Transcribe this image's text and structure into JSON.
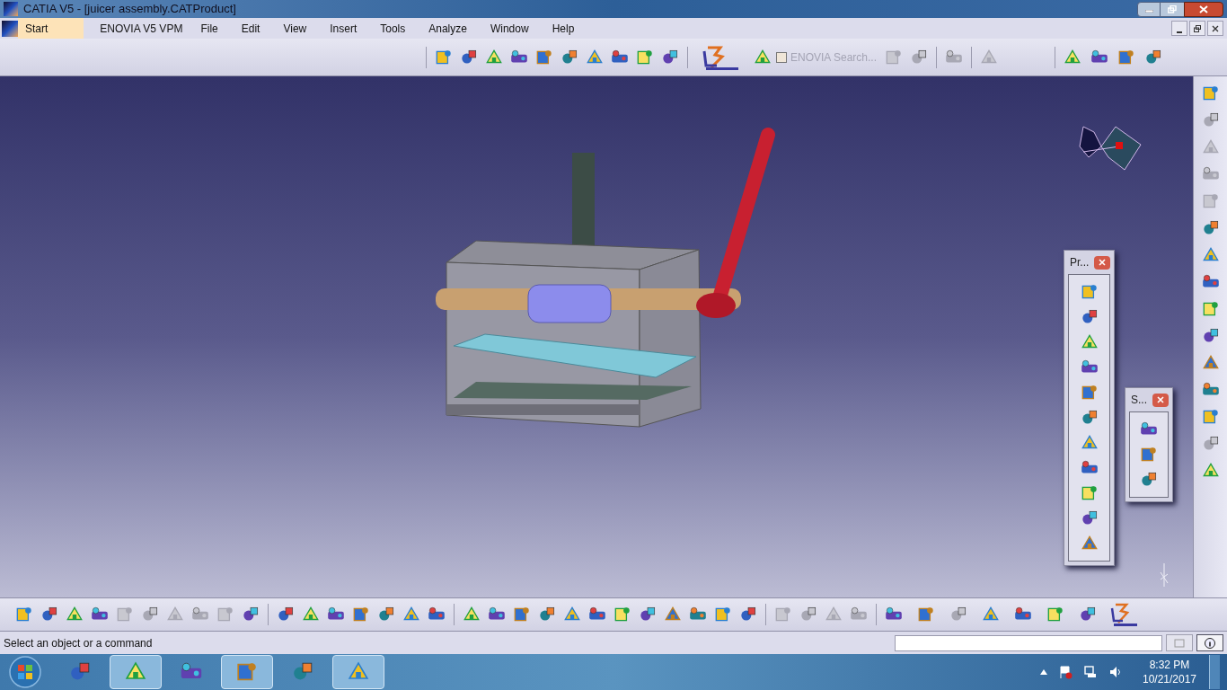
{
  "window": {
    "title": "CATIA V5 - [juicer assembly.CATProduct]"
  },
  "menu": [
    {
      "label": "Start",
      "selected": true
    },
    {
      "label": "ENOVIA V5 VPM",
      "selected": false
    },
    {
      "label": "File",
      "selected": false
    },
    {
      "label": "Edit",
      "selected": false
    },
    {
      "label": "View",
      "selected": false
    },
    {
      "label": "Insert",
      "selected": false
    },
    {
      "label": "Tools",
      "selected": false
    },
    {
      "label": "Analyze",
      "selected": false
    },
    {
      "label": "Window",
      "selected": false
    },
    {
      "label": "Help",
      "selected": false
    }
  ],
  "enovia_search": {
    "label": "ENOVIA Search...",
    "checked": false,
    "disabled": true
  },
  "floating_toolbars": [
    {
      "title": "Pr..."
    },
    {
      "title": "S..."
    }
  ],
  "status_bar": {
    "message": "Select an object or a command"
  },
  "taskbar": {
    "apps": [
      {
        "running": false
      },
      {
        "running": true
      },
      {
        "running": false
      },
      {
        "running": true
      },
      {
        "running": false
      },
      {
        "running": true
      }
    ],
    "clock": {
      "time": "8:32 PM",
      "date": "10/21/2017"
    }
  }
}
